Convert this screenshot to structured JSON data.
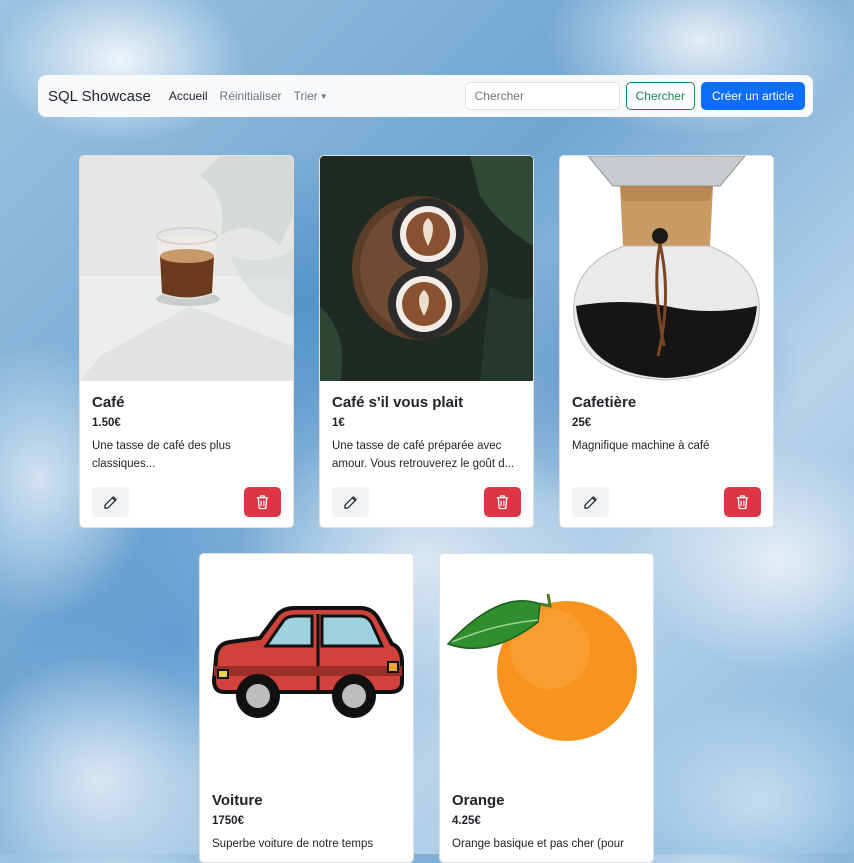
{
  "navbar": {
    "brand": "SQL Showcase",
    "links": [
      "Accueil",
      "Réinitialiser"
    ],
    "sort_label": "Trier",
    "search_placeholder": "Chercher",
    "search_button": "Chercher",
    "create_button": "Créer un article"
  },
  "cards": [
    {
      "title": "Café",
      "price": "1.50€",
      "description": "Une tasse de café des plus classiques...",
      "image": "coffee-glass"
    },
    {
      "title": "Café s'il vous plait",
      "price": "1€",
      "description": "Une tasse de café préparée avec amour. Vous retrouverez le goût d...",
      "image": "latte-cups"
    },
    {
      "title": "Cafetière",
      "price": "25€",
      "description": "Magnifique machine à café",
      "image": "coffee-maker"
    },
    {
      "title": "Voiture",
      "price": "1750€",
      "description": "Superbe voiture de notre temps",
      "image": "red-car"
    },
    {
      "title": "Orange",
      "price": "4.25€",
      "description": "Orange basique et pas cher (pour",
      "image": "orange-fruit"
    }
  ],
  "icons": {
    "edit": "pencil-icon",
    "delete": "trash-icon"
  },
  "colors": {
    "primary": "#0d6efd",
    "success": "#198754",
    "danger": "#dc3545"
  }
}
